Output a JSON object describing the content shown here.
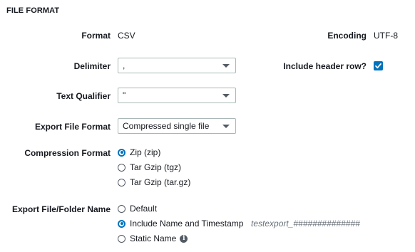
{
  "section": {
    "title": "FILE FORMAT"
  },
  "format": {
    "label": "Format",
    "value": "CSV"
  },
  "encoding": {
    "label": "Encoding",
    "value": "UTF-8"
  },
  "delimiter": {
    "label": "Delimiter",
    "selected": ","
  },
  "include_header": {
    "label": "Include header row?",
    "checked": true
  },
  "text_qualifier": {
    "label": "Text Qualifier",
    "selected": "\""
  },
  "export_file_format": {
    "label": "Export File Format",
    "selected": "Compressed single file"
  },
  "compression_format": {
    "label": "Compression Format",
    "options": [
      {
        "label": "Zip (zip)",
        "checked": true
      },
      {
        "label": "Tar Gzip (tgz)",
        "checked": false
      },
      {
        "label": "Tar Gzip (tar.gz)",
        "checked": false
      }
    ]
  },
  "export_name": {
    "label": "Export File/Folder Name",
    "options": [
      {
        "label": "Default",
        "checked": false
      },
      {
        "label": "Include Name and Timestamp",
        "checked": true
      },
      {
        "label": "Static Name",
        "checked": false
      }
    ],
    "timestamp_example": "testexport_##############"
  },
  "colors": {
    "accent": "#0073bb",
    "text": "#16191f",
    "hint": "#687078",
    "border": "#aab7b8"
  }
}
